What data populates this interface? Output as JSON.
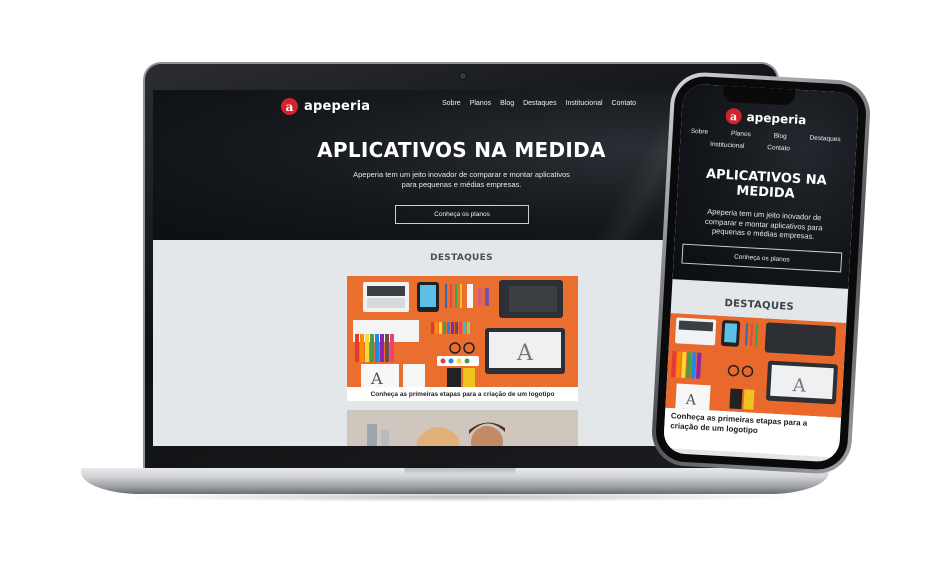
{
  "site": {
    "logo_letter": "a",
    "logo_text": "apeperia",
    "nav": [
      "Sobre",
      "Planos",
      "Blog",
      "Destaques",
      "Institucional",
      "Contato"
    ],
    "hero_title": "APLICATIVOS NA MEDIDA",
    "hero_subtitle_line1": "Apeperia tem um jeito inovador de comparar e montar aplicativos",
    "hero_subtitle_line2": "para pequenas e médias empresas.",
    "cta_label": "Conheça os planos",
    "section_title": "DESTAQUES",
    "card_caption": "Conheça as primeiras etapas para a criação de um logotipo"
  },
  "phone": {
    "nav_row1": [
      "Sobre",
      "Planos",
      "Blog",
      "Destaques"
    ],
    "nav_row2": [
      "Institucional",
      "Contato"
    ],
    "hero_title_line1": "APLICATIVOS NA",
    "hero_title_line2": "MEDIDA",
    "hero_subtitle_line1": "Apeperia tem um jeito inovador de",
    "hero_subtitle_line2": "comparar e montar aplicativos para",
    "hero_subtitle_line3": "pequenas e médias empresas.",
    "caption_line1": "Conheça as primeiras etapas para a",
    "caption_line2": "criação de um logotipo"
  },
  "colors": {
    "brand_red": "#d1242f",
    "hero_dark": "#15181c",
    "page_bg": "#e4e7ea",
    "card_orange": "#e8692b"
  }
}
